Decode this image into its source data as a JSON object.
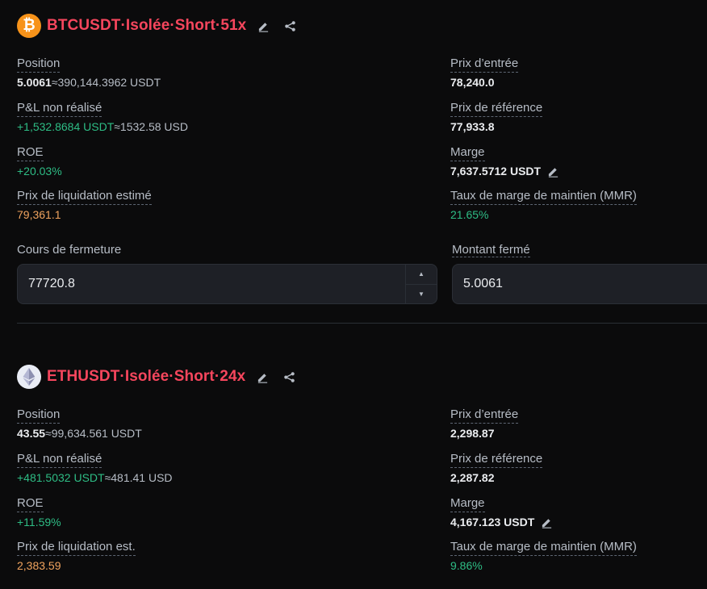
{
  "positions": [
    {
      "icon": "bitcoin-icon",
      "coin_glyph": "₿",
      "title": "BTCUSDT·Isolée·Short·51x",
      "left": [
        {
          "label": "Position",
          "value": "5.0061",
          "sub": "≈390,144.3962 USDT"
        },
        {
          "label": "P&L non réalisé",
          "value": "+1,532.8684 USDT",
          "sub": "≈1532.58 USD"
        },
        {
          "label": "ROE",
          "value": "+20.03%"
        },
        {
          "label": "Prix de liquidation estimé",
          "value": "79,361.1"
        }
      ],
      "right": [
        {
          "label": "Prix d’entrée",
          "value": "78,240.0"
        },
        {
          "label": "Prix de référence",
          "value": "77,933.8"
        },
        {
          "label": "Marge",
          "value": "7,637.5712 USDT"
        },
        {
          "label": "Taux de marge de maintien (MMR)",
          "value": "21.65%"
        }
      ],
      "close_price_label": "Cours de fermeture",
      "close_price_value": "77720.8",
      "close_amount_label": "Montant fermé",
      "close_amount_value": "5.0061"
    },
    {
      "icon": "ethereum-icon",
      "title": "ETHUSDT·Isolée·Short·24x",
      "left": [
        {
          "label": "Position",
          "value": "43.55",
          "sub": "≈99,634.561 USDT"
        },
        {
          "label": "P&L non réalisé",
          "value": "+481.5032 USDT",
          "sub": "≈481.41 USD"
        },
        {
          "label": "ROE",
          "value": "+11.59%"
        },
        {
          "label": "Prix de liquidation est.",
          "value": "2,383.59"
        }
      ],
      "right": [
        {
          "label": "Prix d’entrée",
          "value": "2,298.87"
        },
        {
          "label": "Prix de référence",
          "value": "2,287.82"
        },
        {
          "label": "Marge",
          "value": "4,167.123 USDT"
        },
        {
          "label": "Taux de marge de maintien (MMR)",
          "value": "9.86%"
        }
      ]
    }
  ],
  "colors": {
    "loss_title": "#f6465d",
    "profit": "#2ebd85",
    "liquidation": "#f0a35e",
    "background": "#0b0b0c"
  }
}
